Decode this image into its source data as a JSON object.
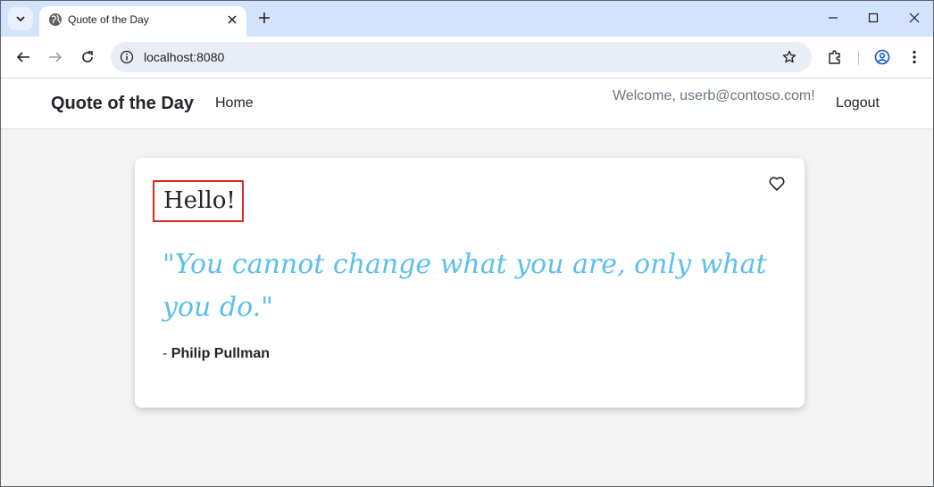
{
  "browser": {
    "tab_title": "Quote of the Day",
    "url": "localhost:8080"
  },
  "site": {
    "brand": "Quote of the Day",
    "nav_home": "Home",
    "welcome": "Welcome, userb@contoso.com!",
    "logout": "Logout"
  },
  "card": {
    "greeting": "Hello!",
    "quote": "\"You cannot change what you are, only what you do.\"",
    "author_prefix": "-",
    "author": "Philip Pullman",
    "favorite_icon": "heart-outline-icon"
  },
  "colors": {
    "tabstrip": "#d3e3fd",
    "quote": "#5bc0eb",
    "highlight_border": "#d9281e"
  }
}
